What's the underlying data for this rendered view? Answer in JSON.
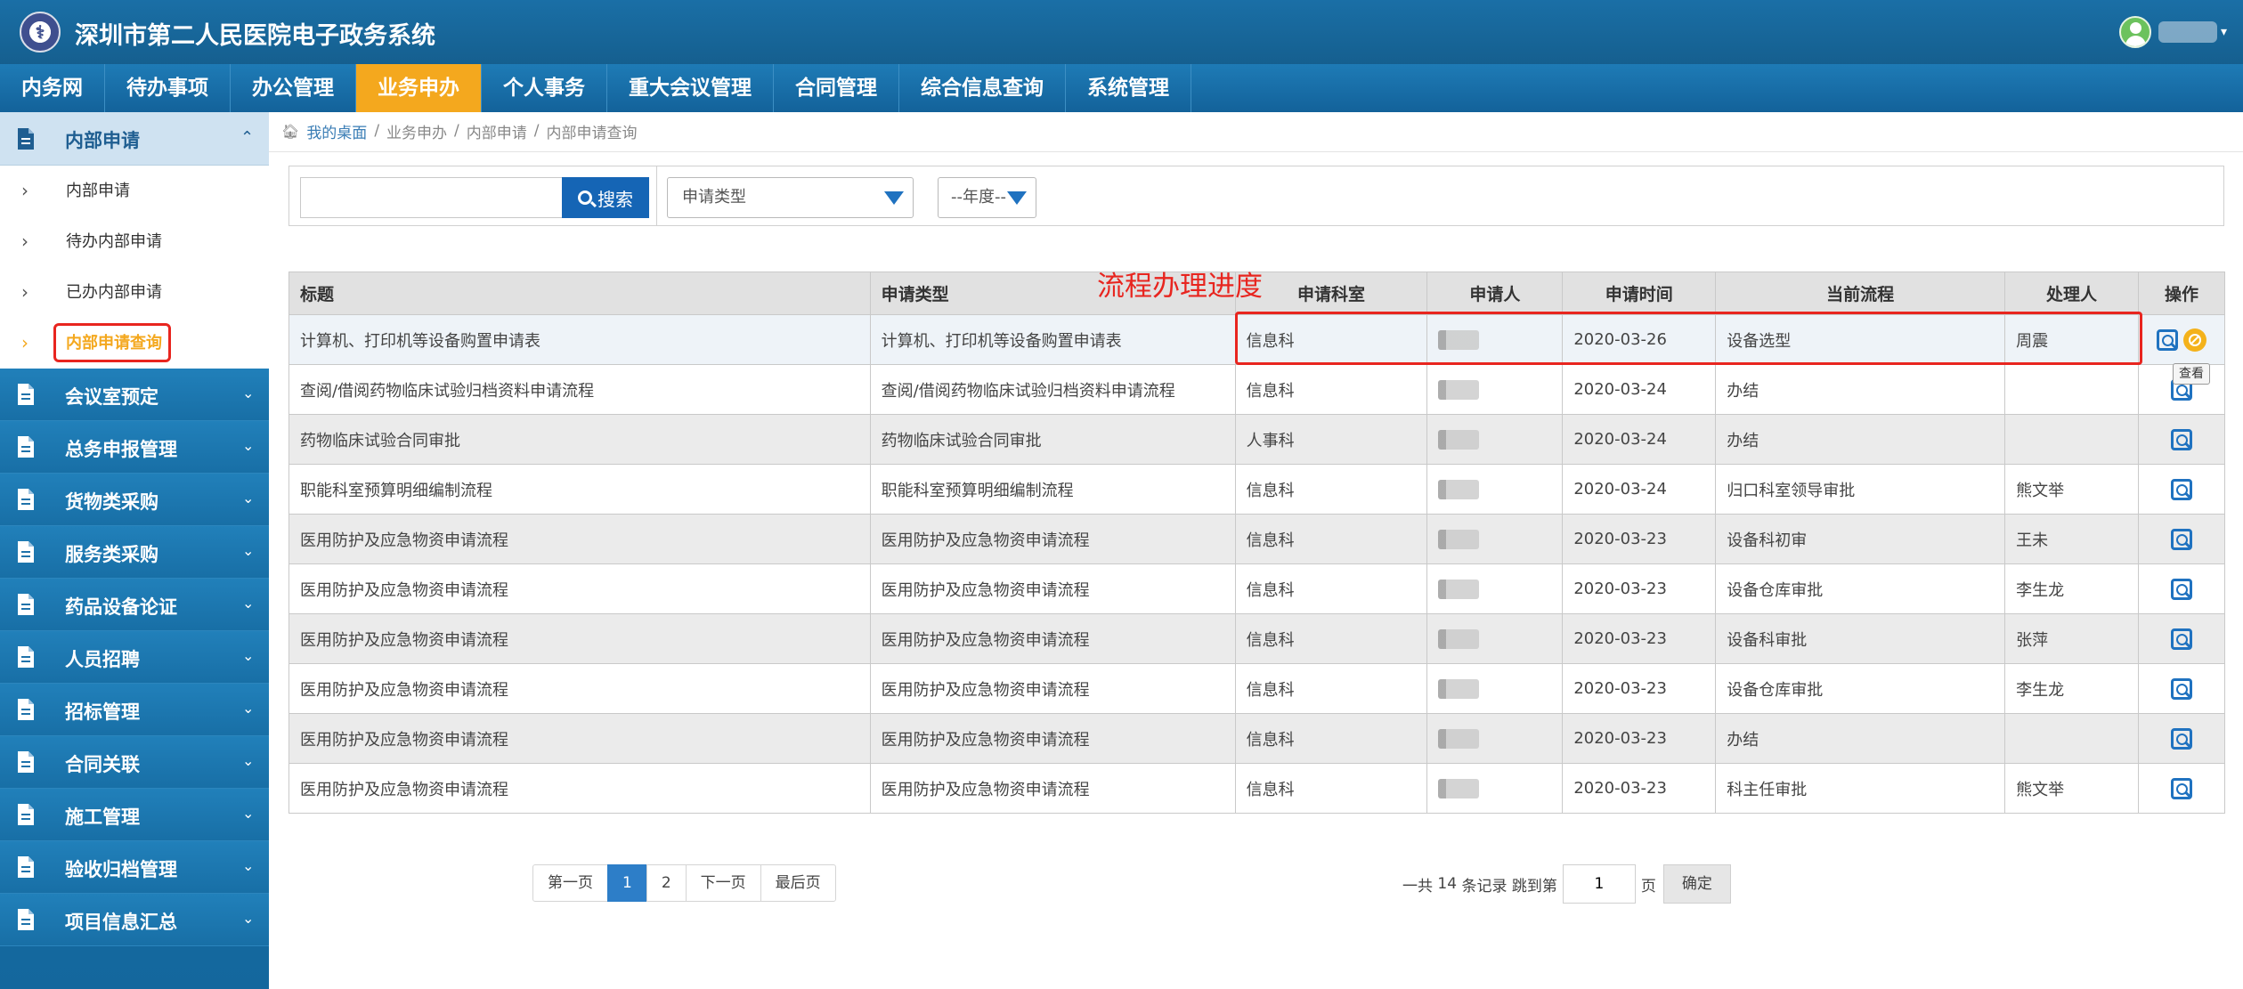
{
  "app": {
    "logo_text": "⚕",
    "title": "深圳市第二人民医院电子政务系统"
  },
  "nav": [
    "内务网",
    "待办事项",
    "办公管理",
    "业务申办",
    "个人事务",
    "重大会议管理",
    "合同管理",
    "综合信息查询",
    "系统管理"
  ],
  "nav_active_index": 3,
  "sidebar": {
    "open_group": "内部申请",
    "sub_items": [
      "内部申请",
      "待办内部申请",
      "已办内部申请",
      "内部申请查询"
    ],
    "current_sub_index": 3,
    "groups": [
      "会议室预定",
      "总务申报管理",
      "货物类采购",
      "服务类采购",
      "药品设备论证",
      "人员招聘",
      "招标管理",
      "合同关联",
      "施工管理",
      "验收归档管理",
      "项目信息汇总"
    ],
    "icon": "document-icon"
  },
  "breadcrumb": {
    "home": "我的桌面",
    "items": [
      "业务申办",
      "内部申请",
      "内部申请查询"
    ]
  },
  "filters": {
    "search_value": "",
    "search_button": "搜索",
    "type_select": "申请类型",
    "year_select": "--年度--"
  },
  "annotation": "流程办理进度",
  "table": {
    "headers": [
      "标题",
      "申请类型",
      "申请科室",
      "申请人",
      "申请时间",
      "当前流程",
      "处理人",
      "操作"
    ],
    "rows": [
      {
        "title": "计算机、打印机等设备购置申请表",
        "type": "计算机、打印机等设备购置申请表",
        "dept": "信息科",
        "date": "2020-03-26",
        "flow": "设备选型",
        "handler": "周震"
      },
      {
        "title": "查阅/借阅药物临床试验归档资料申请流程",
        "type": "查阅/借阅药物临床试验归档资料申请流程",
        "dept": "信息科",
        "date": "2020-03-24",
        "flow": "办结",
        "handler": ""
      },
      {
        "title": "药物临床试验合同审批",
        "type": "药物临床试验合同审批",
        "dept": "人事科",
        "date": "2020-03-24",
        "flow": "办结",
        "handler": ""
      },
      {
        "title": "职能科室预算明细编制流程",
        "type": "职能科室预算明细编制流程",
        "dept": "信息科",
        "date": "2020-03-24",
        "flow": "归口科室领导审批",
        "handler": "熊文举"
      },
      {
        "title": "医用防护及应急物资申请流程",
        "type": "医用防护及应急物资申请流程",
        "dept": "信息科",
        "date": "2020-03-23",
        "flow": "设备科初审",
        "handler": "王未"
      },
      {
        "title": "医用防护及应急物资申请流程",
        "type": "医用防护及应急物资申请流程",
        "dept": "信息科",
        "date": "2020-03-23",
        "flow": "设备仓库审批",
        "handler": "李生龙"
      },
      {
        "title": "医用防护及应急物资申请流程",
        "type": "医用防护及应急物资申请流程",
        "dept": "信息科",
        "date": "2020-03-23",
        "flow": "设备科审批",
        "handler": "张萍"
      },
      {
        "title": "医用防护及应急物资申请流程",
        "type": "医用防护及应急物资申请流程",
        "dept": "信息科",
        "date": "2020-03-23",
        "flow": "设备仓库审批",
        "handler": "李生龙"
      },
      {
        "title": "医用防护及应急物资申请流程",
        "type": "医用防护及应急物资申请流程",
        "dept": "信息科",
        "date": "2020-03-23",
        "flow": "办结",
        "handler": ""
      },
      {
        "title": "医用防护及应急物资申请流程",
        "type": "医用防护及应急物资申请流程",
        "dept": "信息科",
        "date": "2020-03-23",
        "flow": "科主任审批",
        "handler": "熊文举"
      }
    ],
    "tooltip": "查看"
  },
  "pagination": {
    "first": "第一页",
    "pages": [
      "1",
      "2"
    ],
    "active_page": "1",
    "next": "下一页",
    "last": "最后页",
    "total_prefix": "一共",
    "total_count": "14",
    "total_suffix": "条记录 跳到第",
    "jump_value": "1",
    "page_unit": "页",
    "confirm": "确定"
  },
  "colors": {
    "header_blue": "#1a6fa6",
    "nav_active": "#f4a81e",
    "annotation_red": "#e8251f",
    "primary_button": "#1565b5"
  }
}
